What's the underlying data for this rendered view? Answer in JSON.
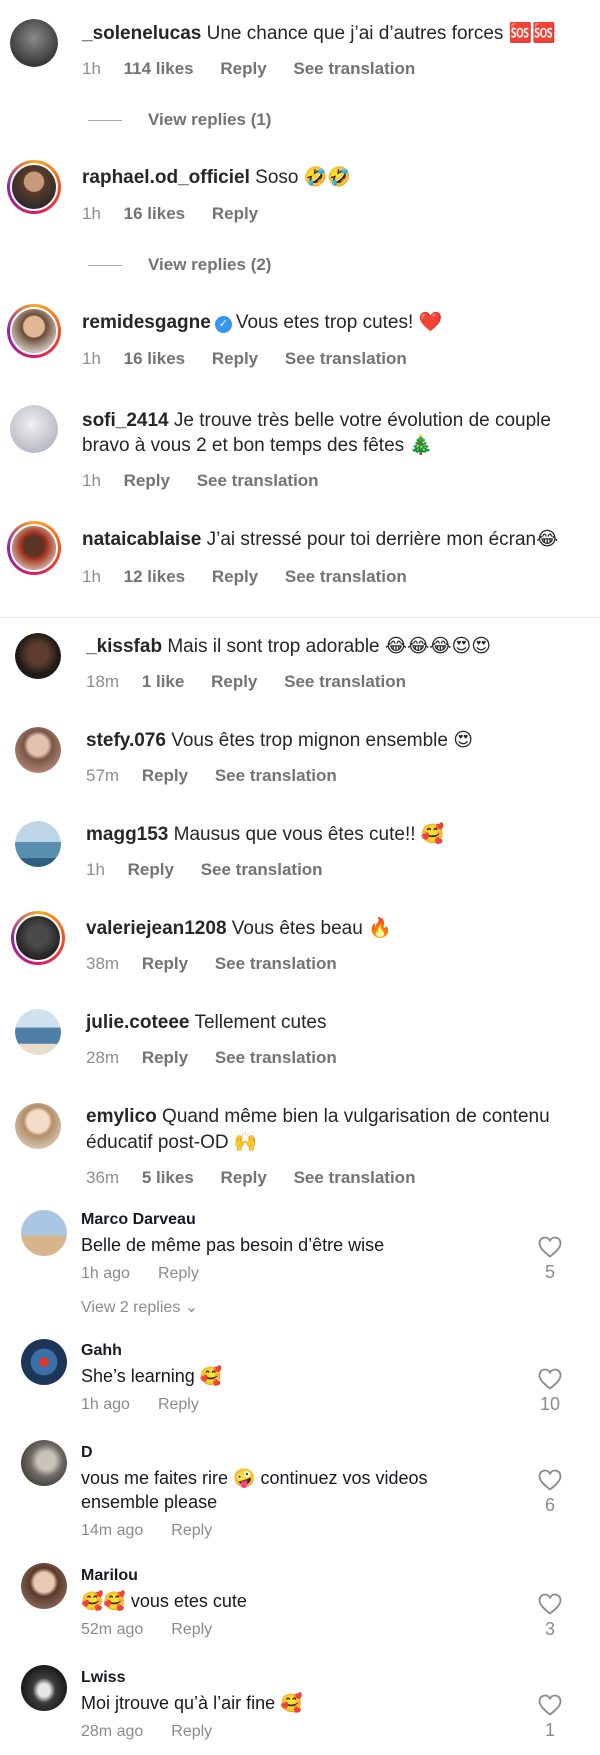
{
  "instagram_comments": [
    {
      "username": "_solenelucas",
      "text": "Une chance que j’ai d’autres forces 🆘🆘",
      "time": "1h",
      "likes": "114 likes",
      "reply": "Reply",
      "translate": "See translation",
      "view_replies": "View replies (1)",
      "avatar_color": "#3a3a3a"
    },
    {
      "username": "raphael.od_officiel",
      "text": "Soso 🤣🤣",
      "time": "1h",
      "likes": "16 likes",
      "reply": "Reply",
      "translate": "",
      "view_replies": "View replies (2)",
      "avatar_color": "#6b4a36"
    },
    {
      "username": "remidesgagne",
      "text": "Vous etes trop cutes! ❤️",
      "time": "1h",
      "likes": "16 likes",
      "reply": "Reply",
      "translate": "See translation",
      "avatar_color": "#8a6a52"
    },
    {
      "username": "sofi_2414",
      "text": "Je trouve très belle votre évolution de couple",
      "text2": "bravo à vous 2 et bon temps des fêtes 🎄",
      "time": "1h",
      "reply": "Reply",
      "translate": "See translation",
      "avatar_color": "#c9ccd3"
    },
    {
      "username": "nataicablaise",
      "text": "J’ai stressé pour toi derrière mon écran😂",
      "time": "1h",
      "likes": "12 likes",
      "reply": "Reply",
      "translate": "See translation",
      "avatar_color": "#a2331f"
    },
    {
      "username": "_kissfab",
      "text": "Mais il sont trop adorable 😂😂😂😍😍",
      "time": "18m",
      "likes": "1 like",
      "reply": "Reply",
      "translate": "See translation",
      "avatar_color": "#1e1a18"
    },
    {
      "username": "stefy.076",
      "text": "Vous êtes trop mignon ensemble 😍",
      "time": "57m",
      "reply": "Reply",
      "translate": "See translation",
      "avatar_color": "#b58a7a"
    },
    {
      "username": "magg153",
      "text": "Mausus que vous êtes cute!! 🥰",
      "time": "1h",
      "reply": "Reply",
      "translate": "See translation",
      "avatar_color": "#5a8fb0"
    },
    {
      "username": "valeriejean1208",
      "text": "Vous êtes beau 🔥",
      "time": "38m",
      "reply": "Reply",
      "translate": "See translation",
      "avatar_color": "#222222"
    },
    {
      "username": "julie.coteee",
      "text": "Tellement cutes",
      "time": "28m",
      "reply": "Reply",
      "translate": "See translation",
      "avatar_color": "#4f7fa6"
    },
    {
      "username": "emylico",
      "text": "Quand même bien la vulgarisation de contenu",
      "text2": "éducatif post-OD 🙌",
      "time": "36m",
      "likes": "5 likes",
      "reply": "Reply",
      "translate": "See translation",
      "avatar_color": "#d9c7b4"
    }
  ],
  "tiktok_comments": [
    {
      "username": "Marco Darveau",
      "text": "Belle de même pas besoin d’être wise",
      "time": "1h ago",
      "reply": "Reply",
      "like_count": "5",
      "view_replies": "View 2 replies",
      "avatar_color": "#7aa0c4"
    },
    {
      "username": "Gahh",
      "text": "She’s learning 🥰",
      "time": "1h ago",
      "reply": "Reply",
      "like_count": "10",
      "avatar_color": "#2a4d7a"
    },
    {
      "username": "D",
      "text": "vous me faites rire 🤪 continuez vos videos",
      "text2": "ensemble please",
      "time": "14m ago",
      "reply": "Reply",
      "like_count": "6",
      "avatar_color": "#6e6a66"
    },
    {
      "username": "Marilou",
      "text": "🥰🥰 vous etes cute",
      "time": "52m ago",
      "reply": "Reply",
      "like_count": "3",
      "avatar_color": "#8b6a5c"
    },
    {
      "username": "Lwiss",
      "text": "Moi jtrouve qu’à l’air fine 🥰",
      "time": "28m ago",
      "reply": "Reply",
      "like_count": "1",
      "avatar_color": "#3c3c3c"
    }
  ]
}
